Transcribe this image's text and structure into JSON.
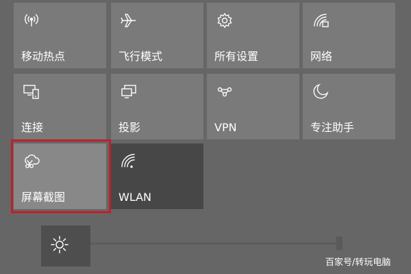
{
  "tiles": [
    {
      "label": "移动热点",
      "icon": "mobile-hotspot-icon"
    },
    {
      "label": "飞行模式",
      "icon": "airplane-icon"
    },
    {
      "label": "所有设置",
      "icon": "gear-icon"
    },
    {
      "label": "网络",
      "icon": "network-icon"
    },
    {
      "label": "连接",
      "icon": "connect-icon"
    },
    {
      "label": "投影",
      "icon": "project-icon"
    },
    {
      "label": "VPN",
      "icon": "vpn-icon"
    },
    {
      "label": "专注助手",
      "icon": "moon-icon"
    },
    {
      "label": "屏幕截图",
      "icon": "screen-snip-icon"
    },
    {
      "label": "WLAN",
      "icon": "wifi-icon"
    }
  ],
  "brightness": {
    "icon": "sun-icon",
    "level": 1.0
  },
  "highlight": {
    "color": "#c0202a"
  },
  "watermark": "百家号/转玩电脑"
}
